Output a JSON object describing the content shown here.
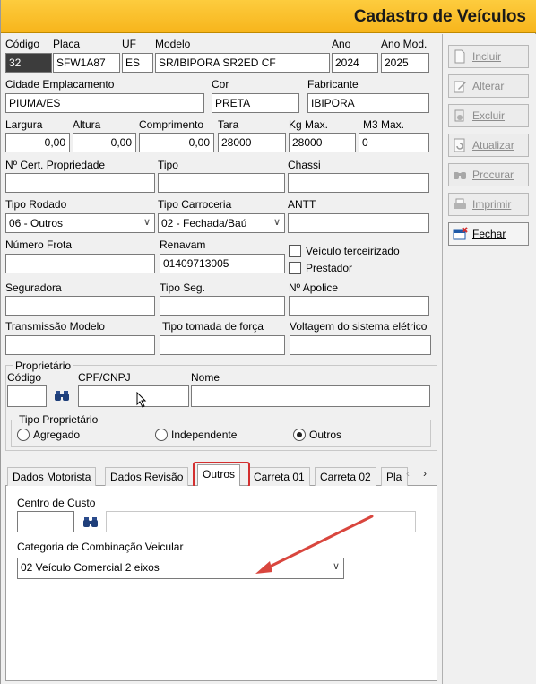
{
  "window": {
    "title": "Cadastro de Veículos"
  },
  "vehicle": {
    "codigo": {
      "label": "Código",
      "value": "32"
    },
    "placa": {
      "label": "Placa",
      "value": "SFW1A87"
    },
    "uf": {
      "label": "UF",
      "value": "ES"
    },
    "modelo": {
      "label": "Modelo",
      "value": "SR/IBIPORA SR2ED CF"
    },
    "ano": {
      "label": "Ano",
      "value": "2024"
    },
    "ano_mod": {
      "label": "Ano Mod.",
      "value": "2025"
    },
    "cidade": {
      "label": "Cidade Emplacamento",
      "value": "PIUMA/ES"
    },
    "cor": {
      "label": "Cor",
      "value": "PRETA"
    },
    "fabricante": {
      "label": "Fabricante",
      "value": "IBIPORA"
    },
    "largura": {
      "label": "Largura",
      "value": "0,00"
    },
    "altura": {
      "label": "Altura",
      "value": "0,00"
    },
    "comprimento": {
      "label": "Comprimento",
      "value": "0,00"
    },
    "tara": {
      "label": "Tara",
      "value": "28000"
    },
    "kg_max": {
      "label": "Kg Max.",
      "value": "28000"
    },
    "m3_max": {
      "label": "M3 Max.",
      "value": "0"
    },
    "cert": {
      "label": "Nº Cert. Propriedade",
      "value": ""
    },
    "tipo": {
      "label": "Tipo",
      "value": ""
    },
    "chassi": {
      "label": "Chassi",
      "value": ""
    },
    "tipo_rodado": {
      "label": "Tipo Rodado",
      "value": "06 - Outros"
    },
    "tipo_carroceria": {
      "label": "Tipo Carroceria",
      "value": "02 - Fechada/Baú"
    },
    "antt": {
      "label": "ANTT",
      "value": ""
    },
    "numero_frota": {
      "label": "Número Frota",
      "value": ""
    },
    "renavam": {
      "label": "Renavam",
      "value": "01409713005"
    },
    "terceirizado": {
      "label": "Veículo terceirizado"
    },
    "prestador": {
      "label": "Prestador"
    },
    "seguradora": {
      "label": "Seguradora",
      "value": ""
    },
    "tipo_seg": {
      "label": "Tipo Seg.",
      "value": ""
    },
    "apolice": {
      "label": "Nº Apolice",
      "value": ""
    },
    "transmissao": {
      "label": "Transmissão Modelo",
      "value": ""
    },
    "tomada_forca": {
      "label": "Tipo tomada de força",
      "value": ""
    },
    "voltagem": {
      "label": "Voltagem do sistema elétrico",
      "value": ""
    }
  },
  "proprietario": {
    "group_label": "Proprietário",
    "codigo_label": "Código",
    "cpf_label": "CPF/CNPJ",
    "nome_label": "Nome",
    "tipo_label": "Tipo Proprietário",
    "options": [
      "Agregado",
      "Independente",
      "Outros"
    ],
    "selected": "Outros"
  },
  "tabs": [
    "Dados Motorista",
    "Dados Revisão",
    "Outros",
    "Carreta 01",
    "Carreta 02",
    "Pla"
  ],
  "active_tab": "Outros",
  "outros": {
    "centro_custo_label": "Centro de Custo",
    "categoria_label": "Categoria de Combinação Veicular",
    "categoria_value": "02 Veículo Comercial 2 eixos"
  },
  "sidebar": {
    "buttons": [
      "Incluir",
      "Alterar",
      "Excluir",
      "Atualizar",
      "Procurar",
      "Imprimir",
      "Fechar"
    ]
  },
  "colors": {
    "titlebar": "#f9bd2a",
    "highlight_box": "#d32f2f",
    "annotation_arrow": "#d9463e"
  }
}
